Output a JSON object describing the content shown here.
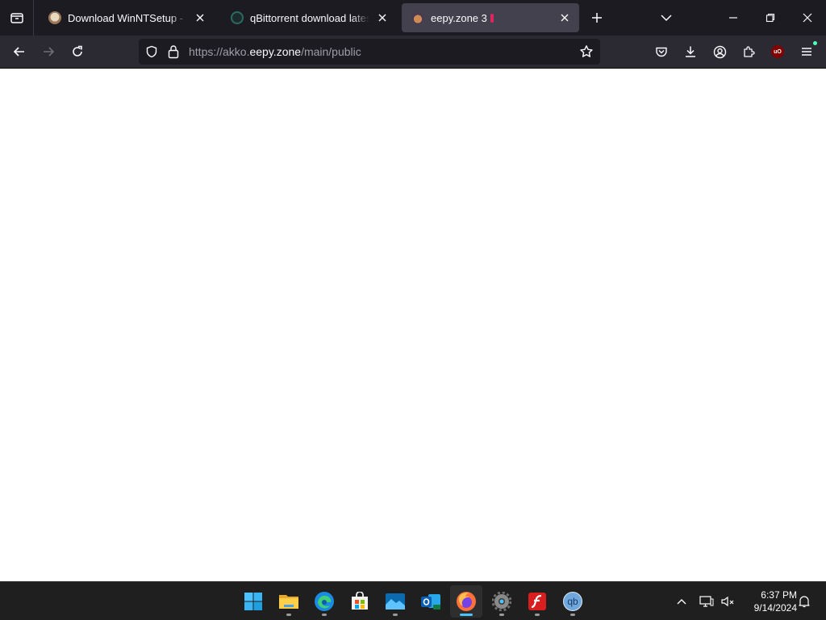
{
  "browser": {
    "tabs": [
      {
        "title": "Download WinNTSetup - Major",
        "active": false
      },
      {
        "title": "qBittorrent download latest ver",
        "active": false
      },
      {
        "title": "eepy.zone 3",
        "active": true
      }
    ],
    "url": {
      "prefix": "https://akko.",
      "domain": "eepy.zone",
      "path": "/main/public"
    },
    "extension_badge": "uO"
  },
  "taskbar": {
    "apps": [
      "start-icon",
      "file-explorer-icon",
      "edge-icon",
      "store-icon",
      "photos-icon",
      "outlook-icon",
      "firefox-icon",
      "settings-icon",
      "flash-icon",
      "qbittorrent-icon"
    ],
    "active_app": "firefox-icon",
    "qbittorrent_label": "qb",
    "time": "6:37 PM",
    "date": "9/14/2024"
  },
  "colors": {
    "tabbar_bg": "#1c1b22",
    "navbar_bg": "#2b2a33",
    "active_tab": "#42414d",
    "taskbar_bg": "#1f1f1f",
    "accent": "#4cc2ff"
  }
}
